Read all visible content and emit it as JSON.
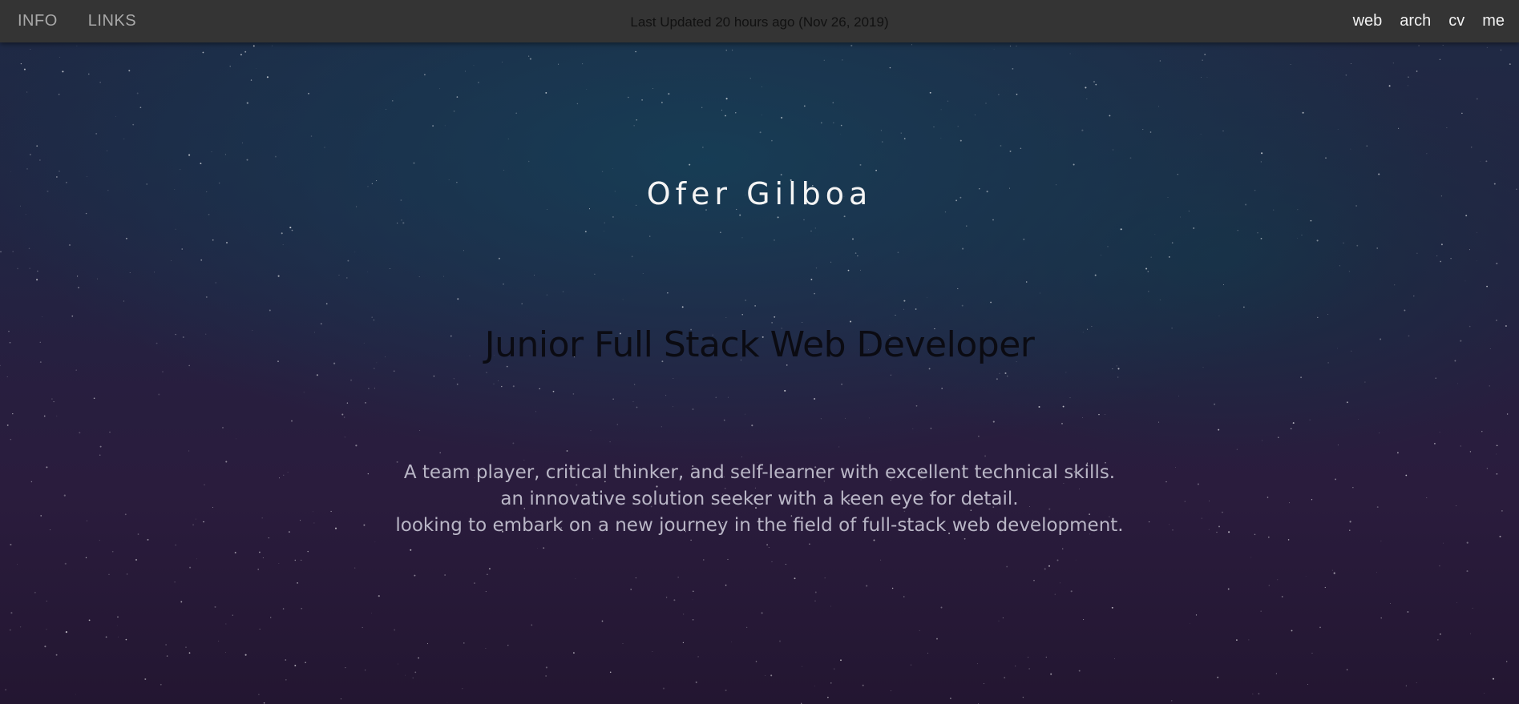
{
  "nav": {
    "left": [
      {
        "label": "INFO"
      },
      {
        "label": "LINKS"
      }
    ],
    "updated": "Last Updated 20 hours ago (Nov 26, 2019)",
    "right": [
      {
        "label": "web"
      },
      {
        "label": "arch"
      },
      {
        "label": "cv"
      },
      {
        "label": "me"
      }
    ]
  },
  "hero": {
    "name": "Ofer Gilboa",
    "role": "Junior Full Stack Web Developer",
    "bio": [
      "A team player, critical thinker, and self-learner with excellent technical skills.",
      "an innovative solution seeker with a keen eye for detail.",
      "looking to embark on a new journey in the field of full-stack web development."
    ]
  },
  "colors": {
    "navbar": "#343434",
    "background": "#241a33",
    "nav_left_text": "#a9a9a9",
    "nav_right_text": "#f2f2f2",
    "name_text": "#f4f4f4",
    "role_text": "#0b0b12",
    "bio_text": "#b9b6c6"
  }
}
